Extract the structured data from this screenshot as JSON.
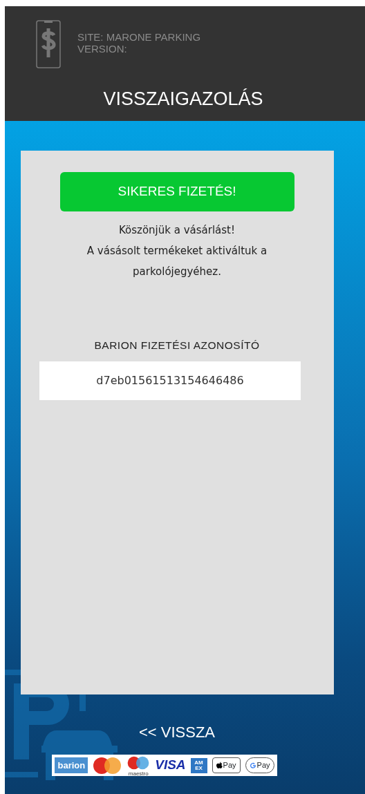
{
  "header": {
    "site": "SITE: MARONE PARKING",
    "version": "VERSION:",
    "title": "VISSZAIGAZOLÁS"
  },
  "status_banner": {
    "text": "SIKERES FIZETÉS!",
    "kind": "success"
  },
  "message_lines": [
    "Köszönjük a vásárlást!",
    "A vásásolt termékeket aktiváltuk a parkolójegyéhez."
  ],
  "transaction": {
    "label": "BARION FIZETÉSI AZONOSÍTÓ",
    "value": "d7eb01561513154646486"
  },
  "back_link": "<< VISSZA",
  "payment_logos": [
    {
      "kind": "barion",
      "text": "barion"
    },
    {
      "kind": "mastercard"
    },
    {
      "kind": "maestro",
      "text": "maestro"
    },
    {
      "kind": "visa",
      "text": "VISA"
    },
    {
      "kind": "amex",
      "text": "AM EX"
    },
    {
      "kind": "applepay",
      "text": "Pay"
    },
    {
      "kind": "gpay",
      "text": "Pay"
    }
  ]
}
